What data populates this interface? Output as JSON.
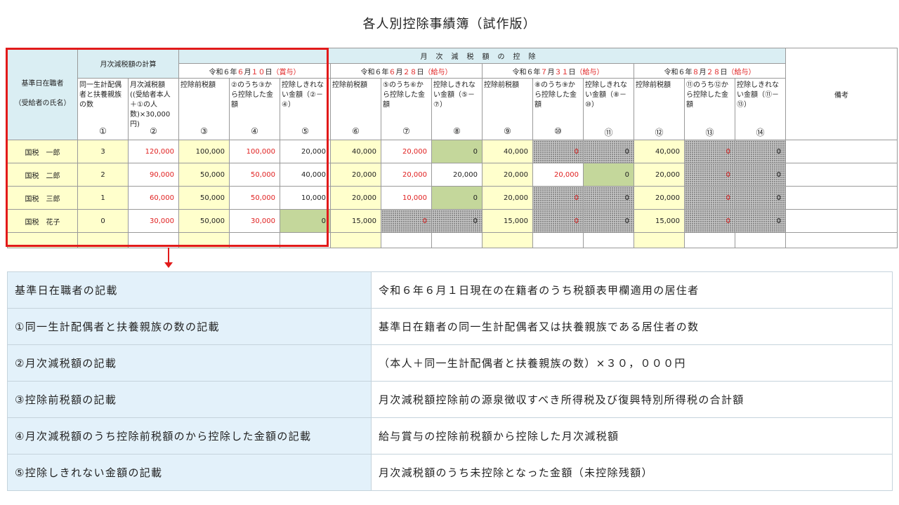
{
  "page_title": "各人別控除事績簿（試作版）",
  "ledger": {
    "col1_header_line1": "基準日在職者",
    "col1_header_line2": "（受給者の氏名）",
    "calc_header": "月次減税額の計算",
    "band_header": "月次減税額の控除",
    "calc_col_a": "同一生計配偶者と扶養親族の数",
    "calc_col_b": "月次減税額((受給者本人＋①の人数)×30,000円)",
    "calc_col_a_no": "①",
    "calc_col_b_no": "②",
    "remarks_header": "備考",
    "payment_dates": [
      {
        "pre": "令和６年",
        "month": "６",
        "mid": "月",
        "day": "１０",
        "post": "日",
        "kind": "（賞与）"
      },
      {
        "pre": "令和６年",
        "month": "６",
        "mid": "月",
        "day": "２８",
        "post": "日",
        "kind": "（給与）"
      },
      {
        "pre": "令和６年",
        "month": "７",
        "mid": "月",
        "day": "３１",
        "post": "日",
        "kind": "（給与）"
      },
      {
        "pre": "令和６年",
        "month": "８",
        "mid": "月",
        "day": "２８",
        "post": "日",
        "kind": "（給与）"
      }
    ],
    "sub_headers": [
      [
        "控除前税額",
        "②のうち③から控除した金額",
        "控除しきれない金額（②－④）"
      ],
      [
        "控除前税額",
        "⑤のうち⑥から控除した金額",
        "控除しきれない金額（⑤－⑦）"
      ],
      [
        "控除前税額",
        "⑧のうち⑨から控除した金額",
        "控除しきれない金額（⑧－⑩）"
      ],
      [
        "控除前税額",
        "⑪のうち⑫から控除した金額",
        "控除しきれない金額（⑪－⑬）"
      ]
    ],
    "col_numbers": [
      [
        "③",
        "④",
        "⑤"
      ],
      [
        "⑥",
        "⑦",
        "⑧"
      ],
      [
        "⑨",
        "⑩",
        "⑪"
      ],
      [
        "⑫",
        "⑬",
        "⑭"
      ]
    ],
    "rows": [
      {
        "name": "国税　一郎",
        "count": "3",
        "reduction": "120,000",
        "groups": [
          [
            "100,000",
            "100,000",
            "20,000"
          ],
          [
            "40,000",
            "20,000",
            "0"
          ],
          [
            "40,000",
            "0",
            "0"
          ],
          [
            "40,000",
            "0",
            "0"
          ]
        ]
      },
      {
        "name": "国税　二郎",
        "count": "2",
        "reduction": "90,000",
        "groups": [
          [
            "50,000",
            "50,000",
            "40,000"
          ],
          [
            "20,000",
            "20,000",
            "20,000"
          ],
          [
            "20,000",
            "20,000",
            "0"
          ],
          [
            "20,000",
            "0",
            "0"
          ]
        ]
      },
      {
        "name": "国税　三郎",
        "count": "1",
        "reduction": "60,000",
        "groups": [
          [
            "50,000",
            "50,000",
            "10,000"
          ],
          [
            "20,000",
            "10,000",
            "0"
          ],
          [
            "20,000",
            "0",
            "0"
          ],
          [
            "20,000",
            "0",
            "0"
          ]
        ]
      },
      {
        "name": "国税　花子",
        "count": "0",
        "reduction": "30,000",
        "groups": [
          [
            "50,000",
            "30,000",
            "0"
          ],
          [
            "15,000",
            "0",
            "0"
          ],
          [
            "15,000",
            "0",
            "0"
          ],
          [
            "15,000",
            "0",
            "0"
          ]
        ]
      }
    ]
  },
  "notes": [
    {
      "label": "基準日在職者の記載",
      "desc": "令和６年６月１日現在の在籍者のうち税額表甲欄適用の居住者"
    },
    {
      "label": "①同一生計配偶者と扶養親族の数の記載",
      "desc": "基準日在籍者の同一生計配偶者又は扶養親族である居住者の数"
    },
    {
      "label": "②月次減税額の記載",
      "desc": "（本人＋同一生計配偶者と扶養親族の数）×３０，０００円"
    },
    {
      "label": "③控除前税額の記載",
      "desc": "月次減税額控除前の源泉徴収すべき所得税及び復興特別所得税の合計額"
    },
    {
      "label": "④月次減税額のうち控除前税額のから控除した金額の記載",
      "desc": "給与賞与の控除前税額から控除した月次減税額"
    },
    {
      "label": "⑤控除しきれない金額の記載",
      "desc": "月次減税額のうち未控除となった金額（未控除残額）"
    }
  ]
}
